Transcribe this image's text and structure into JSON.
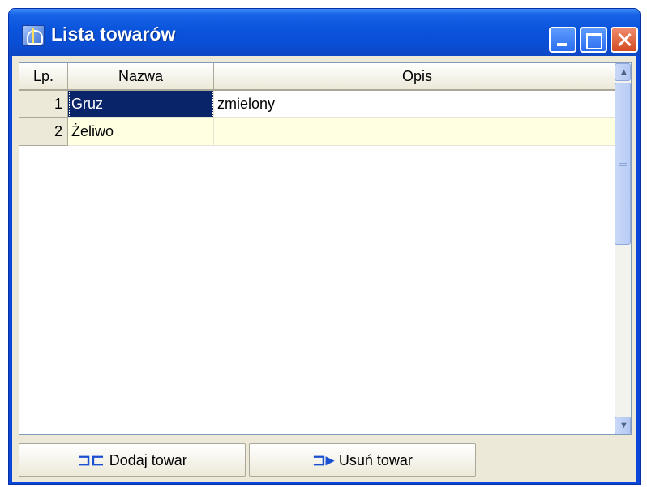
{
  "window": {
    "title": "Lista towarów",
    "icons": {
      "app": "app-scale-icon",
      "minimize": "minimize-icon",
      "maximize": "maximize-icon",
      "close": "close-icon"
    }
  },
  "grid": {
    "columns": [
      "Lp.",
      "Nazwa",
      "Opis"
    ],
    "rows": [
      {
        "lp": "1",
        "nazwa": "Gruz",
        "opis": "zmielony"
      },
      {
        "lp": "2",
        "nazwa": "Żeliwo",
        "opis": ""
      }
    ]
  },
  "toolbar": {
    "add_label": "Dodaj towar",
    "delete_label": "Usuń towar"
  },
  "colors": {
    "titlebar": "#0a54dc",
    "selection": "#0a246a",
    "alt_row": "#ffffe1",
    "face": "#ece9d8"
  }
}
